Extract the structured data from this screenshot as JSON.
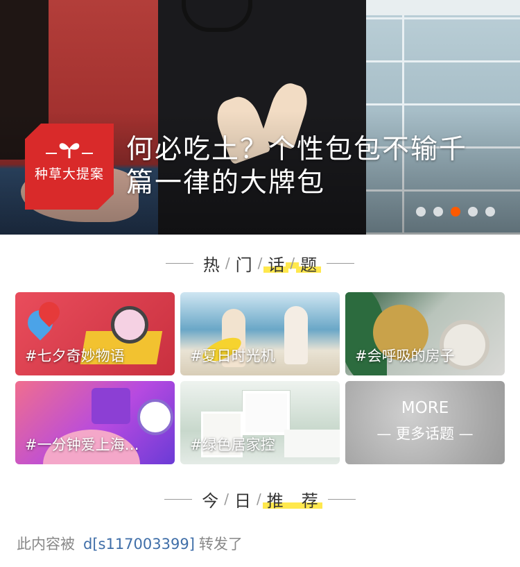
{
  "banner": {
    "badge_text": "种草大提案",
    "title": "何必吃土？个性包包不输千篇一律的大牌包",
    "dots": [
      {
        "active": false
      },
      {
        "active": false
      },
      {
        "active": true
      },
      {
        "active": false
      },
      {
        "active": false
      }
    ],
    "active_dot_color": "#ff5a00",
    "badge_color": "#d92a2a"
  },
  "hot_topics": {
    "heading": [
      "热",
      "门",
      "话",
      "题"
    ],
    "tiles": [
      {
        "label": "#七夕奇妙物语"
      },
      {
        "label": "#夏日时光机"
      },
      {
        "label": "#会呼吸的房子"
      },
      {
        "label": "#一分钟爱上海…"
      },
      {
        "label": "#绿色居家控"
      }
    ],
    "more": {
      "title": "MORE",
      "sub": "— 更多话题 —"
    }
  },
  "today": {
    "heading": [
      "今",
      "日",
      "推",
      "荐"
    ]
  },
  "feed": {
    "prefix": "此内容被",
    "user": "d[s117003399]",
    "suffix": "转发了"
  },
  "colors": {
    "highlight": "#ffe84d",
    "user_link": "#3f6ea8"
  }
}
